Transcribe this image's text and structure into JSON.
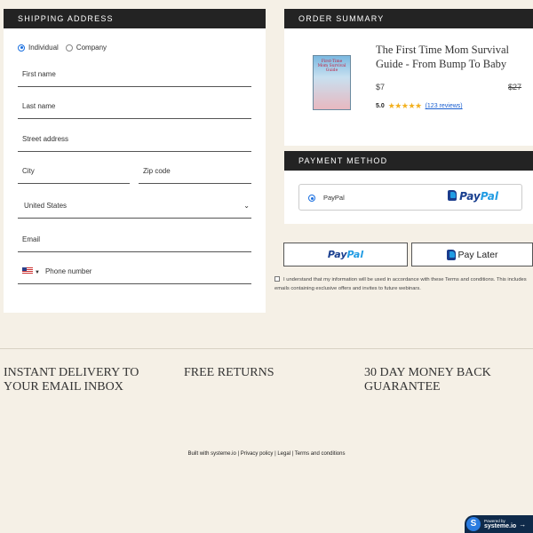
{
  "shipping": {
    "header": "SHIPPING ADDRESS",
    "types": [
      "Individual",
      "Company"
    ],
    "first_name_placeholder": "First name",
    "last_name_placeholder": "Last name",
    "street_placeholder": "Street address",
    "city_placeholder": "City",
    "zip_placeholder": "Zip code",
    "country_value": "United States",
    "email_placeholder": "Email",
    "phone_placeholder": "Phone number"
  },
  "order": {
    "header": "ORDER SUMMARY",
    "product_name": "The First Time Mom Survival Guide - From Bump To Baby",
    "book_cover_title": "First-Time Mom Survival Guide",
    "price": "$7",
    "old_price": "$27",
    "rating": "5.0",
    "stars": "★★★★★",
    "reviews": "(123 reviews)"
  },
  "payment": {
    "header": "PAYMENT METHOD",
    "option_label": "PayPal",
    "logo_part1": "Pay",
    "logo_part2": "Pal"
  },
  "buttons": {
    "paypal_part1": "Pay",
    "paypal_part2": "Pal",
    "pay_later": "Pay Later"
  },
  "consent": "I understand that my information will be used in accordance with these Terms and conditions. This includes emails containing exclusive offers and invites to future webinars.",
  "features": [
    "INSTANT DELIVERY TO YOUR EMAIL INBOX",
    "FREE RETURNS",
    "30 DAY MONEY BACK GUARANTEE"
  ],
  "footer": "Built with systeme.io | Privacy policy | Legal | Terms and conditions",
  "badge": {
    "powered": "Powered by",
    "brand": "systeme.io"
  },
  "colors": {
    "header_bg": "#232323",
    "page_bg": "#f5f0e6",
    "link": "#1a5fd0",
    "star": "#f2b01e",
    "paypal_dark": "#193f8f",
    "paypal_light": "#229ce3"
  }
}
